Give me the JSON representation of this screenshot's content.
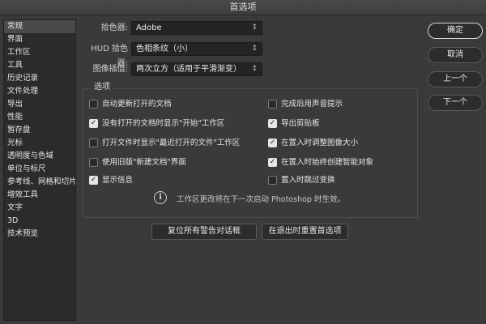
{
  "window": {
    "title": "首选项"
  },
  "sidebar": {
    "items": [
      {
        "label": "常规",
        "active": true
      },
      {
        "label": "界面"
      },
      {
        "label": "工作区"
      },
      {
        "label": "工具"
      },
      {
        "label": "历史记录"
      },
      {
        "label": "文件处理"
      },
      {
        "label": "导出"
      },
      {
        "label": "性能"
      },
      {
        "label": "暂存盘"
      },
      {
        "label": "光标"
      },
      {
        "label": "透明度与色域"
      },
      {
        "label": "单位与标尺"
      },
      {
        "label": "参考线、网格和切片"
      },
      {
        "label": "增效工具"
      },
      {
        "label": "文字"
      },
      {
        "label": "3D"
      },
      {
        "label": "技术预览"
      }
    ]
  },
  "fields": {
    "color_picker": {
      "label": "拾色器:",
      "value": "Adobe"
    },
    "hud_color_picker": {
      "label": "HUD 拾色器:",
      "value": "色相条纹（小）"
    },
    "image_interpolation": {
      "label": "图像插值:",
      "value": "两次立方（适用于平滑渐变）"
    }
  },
  "options": {
    "legend": "选项",
    "checkboxes": [
      {
        "label": "自动更新打开的文档",
        "checked": false
      },
      {
        "label": "没有打开的文档时显示\"开始\"工作区",
        "checked": true
      },
      {
        "label": "打开文件时显示\"最近打开的文件\"工作区",
        "checked": false
      },
      {
        "label": "使用旧版\"新建文档\"界面",
        "checked": false
      },
      {
        "label": "显示信息",
        "checked": true
      },
      {
        "label": "完成后用声音提示",
        "checked": false
      },
      {
        "label": "导出剪贴板",
        "checked": true
      },
      {
        "label": "在置入时调整图像大小",
        "checked": true
      },
      {
        "label": "在置入时始终创建智能对象",
        "checked": true
      },
      {
        "label": "置入时跳过变换",
        "checked": false
      }
    ],
    "info_text": "工作区更改将在下一次启动 Photoshop 时生效。"
  },
  "buttons": {
    "ok": "确定",
    "cancel": "取消",
    "prev": "上一个",
    "next": "下一个",
    "reset_warnings": "复位所有警告对话框",
    "reset_on_quit": "在退出时重置首选项"
  },
  "icons": {
    "dropdown": "chevron-updown-icon",
    "info": "info-icon",
    "check": "checkmark-icon"
  }
}
